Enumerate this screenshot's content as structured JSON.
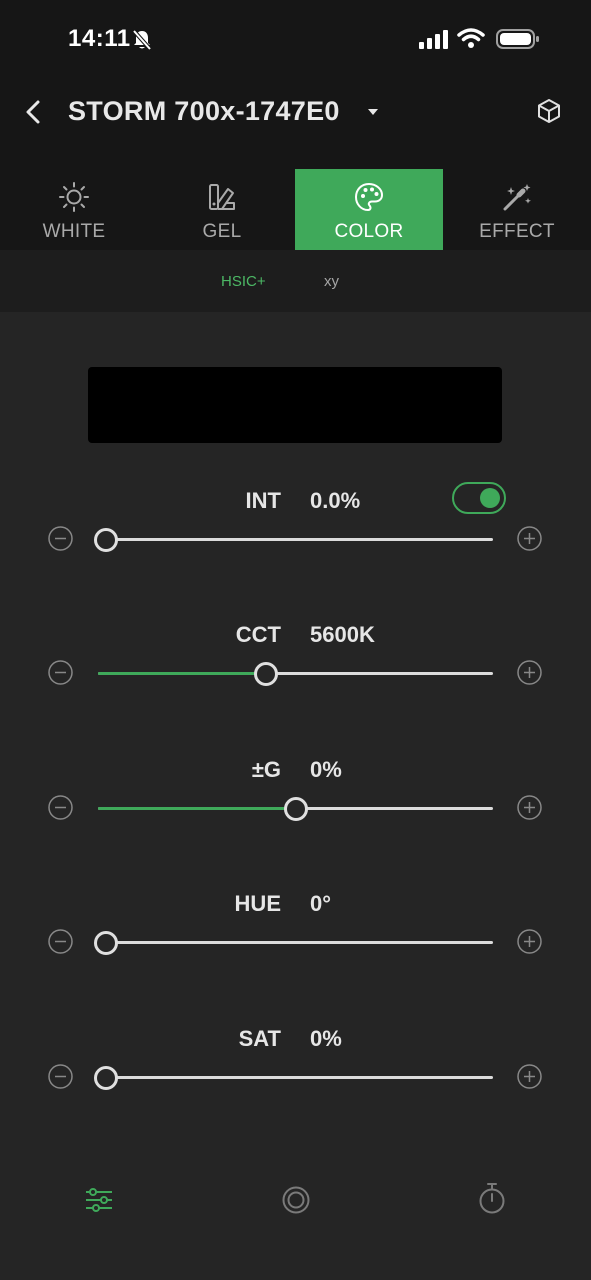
{
  "status_bar": {
    "time": "14:11"
  },
  "header": {
    "device_name": "STORM 700x-1747E0"
  },
  "tabs": [
    {
      "label": "WHITE",
      "icon": "sun-icon",
      "active": false
    },
    {
      "label": "GEL",
      "icon": "gel-swatch-icon",
      "active": false
    },
    {
      "label": "COLOR",
      "icon": "palette-icon",
      "active": true
    },
    {
      "label": "EFFECT",
      "icon": "magic-wand-icon",
      "active": false
    }
  ],
  "subtabs": [
    {
      "label": "HSIC+",
      "active": true
    },
    {
      "label": "xy",
      "active": false
    }
  ],
  "params": [
    {
      "label": "INT",
      "value": "0.0%",
      "level": 0.0,
      "toggle_on": true
    },
    {
      "label": "CCT",
      "value": "5600K",
      "level": 0.42
    },
    {
      "label": "±G",
      "value": "0%",
      "level": 0.5
    },
    {
      "label": "HUE",
      "value": "0°",
      "level": 0.0
    },
    {
      "label": "SAT",
      "value": "0%",
      "level": 0.0
    }
  ],
  "bottom_nav": [
    {
      "icon": "sliders-icon",
      "active": true
    },
    {
      "icon": "circle-target-icon",
      "active": false
    },
    {
      "icon": "timer-icon",
      "active": false
    }
  ],
  "colors": {
    "accent": "#3fa95a",
    "background": "#252525",
    "header": "#161616"
  }
}
